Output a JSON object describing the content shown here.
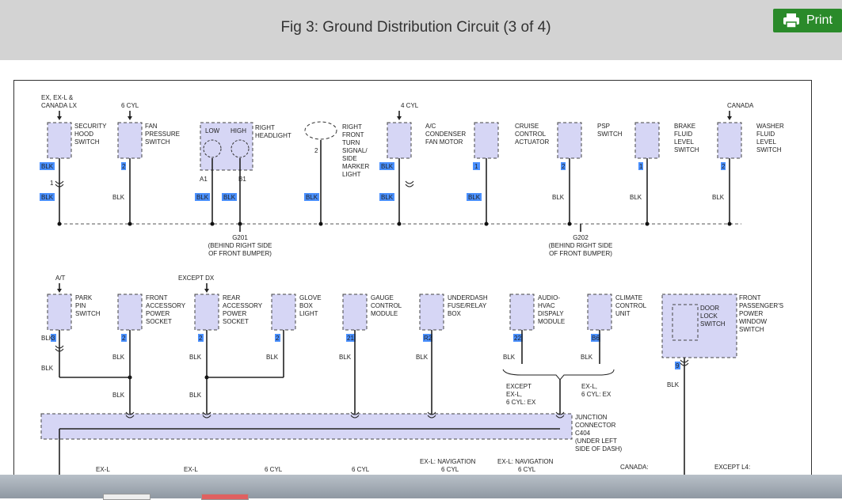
{
  "header": {
    "title": "Fig 3: Ground Distribution Circuit (3 of 4)",
    "print_label": "Print"
  },
  "diagram": {
    "top_row": [
      {
        "id": "security-hood-switch",
        "qual": [
          "EX, EX-L &",
          "CANADA LX"
        ],
        "label": [
          "SECURITY",
          "HOOD",
          "SWITCH"
        ],
        "pin": "",
        "wire_top": "BLK",
        "extra_pin": "1",
        "wire": "BLK",
        "hl": true
      },
      {
        "id": "fan-pressure-switch",
        "qual": [
          "6 CYL"
        ],
        "label": [
          "FAN",
          "PRESSURE",
          "SWITCH"
        ],
        "pin": "2",
        "wire": "BLK",
        "hl": false
      },
      {
        "id": "ac-condenser-fan-motor",
        "qual": [
          "4 CYL"
        ],
        "label": [
          "A/C",
          "CONDENSER",
          "FAN MOTOR"
        ],
        "pin": "",
        "wire_top": "BLK",
        "wire": "BLK",
        "hl": true
      },
      {
        "id": "cruise-control-actuator",
        "qual": [],
        "label": [
          "CRUISE",
          "CONTROL",
          "ACTUATOR"
        ],
        "pin": "1",
        "wire": "BLK",
        "hl": true
      },
      {
        "id": "psp-switch",
        "qual": [],
        "label": [
          "PSP",
          "SWITCH"
        ],
        "pin": "2",
        "wire": "BLK",
        "hl": false
      },
      {
        "id": "brake-fluid-level-switch",
        "qual": [],
        "label": [
          "BRAKE",
          "FLUID",
          "LEVEL",
          "SWITCH"
        ],
        "pin": "1",
        "wire": "BLK",
        "hl": false
      },
      {
        "id": "washer-fluid-level-switch",
        "qual": [
          "CANADA"
        ],
        "label": [
          "WASHER",
          "FLUID",
          "LEVEL",
          "SWITCH"
        ],
        "pin": "2",
        "wire": "BLK",
        "hl": false
      }
    ],
    "headlight": {
      "label": [
        "RIGHT",
        "HEADLIGHT"
      ],
      "low": "LOW",
      "high": "HIGH",
      "pin_a": "A1",
      "pin_b": "B1",
      "wire": "BLK"
    },
    "turn_signal": {
      "label": [
        "RIGHT",
        "FRONT",
        "TURN",
        "SIGNAL/",
        "SIDE",
        "MARKER",
        "LIGHT"
      ],
      "pin": "2",
      "wire": "BLK"
    },
    "grounds": [
      {
        "name": "G201",
        "desc": [
          "(BEHIND RIGHT SIDE",
          "OF FRONT BUMPER)"
        ]
      },
      {
        "name": "G202",
        "desc": [
          "(BEHIND RIGHT SIDE",
          "OF FRONT BUMPER)"
        ]
      }
    ],
    "bottom_row": [
      {
        "id": "park-pin-switch",
        "qual": [
          "A/T"
        ],
        "label": [
          "PARK",
          "PIN",
          "SWITCH"
        ],
        "pin": "3",
        "wire": "BLK"
      },
      {
        "id": "front-accessory-power-socket",
        "qual": [],
        "label": [
          "FRONT",
          "ACCESSORY",
          "POWER",
          "SOCKET"
        ],
        "pin": "2",
        "wire": "BLK"
      },
      {
        "id": "rear-accessory-power-socket",
        "qual": [
          "EXCEPT DX"
        ],
        "label": [
          "REAR",
          "ACCESSORY",
          "POWER",
          "SOCKET"
        ],
        "pin": "2",
        "wire": "BLK"
      },
      {
        "id": "glove-box-light",
        "qual": [],
        "label": [
          "GLOVE",
          "BOX",
          "LIGHT"
        ],
        "pin": "2",
        "wire": "BLK"
      },
      {
        "id": "gauge-control-module",
        "qual": [],
        "label": [
          "GAUGE",
          "CONTROL",
          "MODULE"
        ],
        "pin": "21",
        "wire": "BLK"
      },
      {
        "id": "underdash-fuse-relay-box",
        "qual": [],
        "label": [
          "UNDERDASH",
          "FUSE/RELAY",
          "BOX"
        ],
        "pin": "R2",
        "wire": "BLK"
      },
      {
        "id": "audio-hvac-display-module",
        "qual": [],
        "label": [
          "AUDIO-",
          "HVAC",
          "DISPALY",
          "MODULE"
        ],
        "pin": "22",
        "wire": "BLK"
      },
      {
        "id": "climate-control-unit",
        "qual": [],
        "label": [
          "CLIMATE",
          "CONTROL",
          "UNIT"
        ],
        "pin": "B6",
        "wire": "BLK"
      }
    ],
    "door_lock": {
      "outer": [
        "FRONT",
        "PASSENGER'S",
        "POWER",
        "WINDOW",
        "SWITCH"
      ],
      "inner": [
        "DOOR",
        "LOCK",
        "SWITCH"
      ],
      "pin": "9",
      "wire": "BLK"
    },
    "junction": {
      "label": [
        "JUNCTION",
        "CONNECTOR",
        "C404",
        "(UNDER LEFT",
        "SIDE OF DASH)"
      ]
    },
    "notes": {
      "except_ex": [
        "EXCEPT",
        "EX-L,",
        "6 CYL: EX"
      ],
      "ex_l": [
        "EX-L,",
        "6 CYL: EX"
      ]
    },
    "bottom_labels": [
      "EX-L",
      "EX-L",
      "6 CYL",
      "6 CYL",
      "EX-L: NAVIGATION",
      "6 CYL",
      "EX-L: NAVIGATION",
      "6 CYL",
      "CANADA:",
      "EXCEPT L4:"
    ]
  }
}
